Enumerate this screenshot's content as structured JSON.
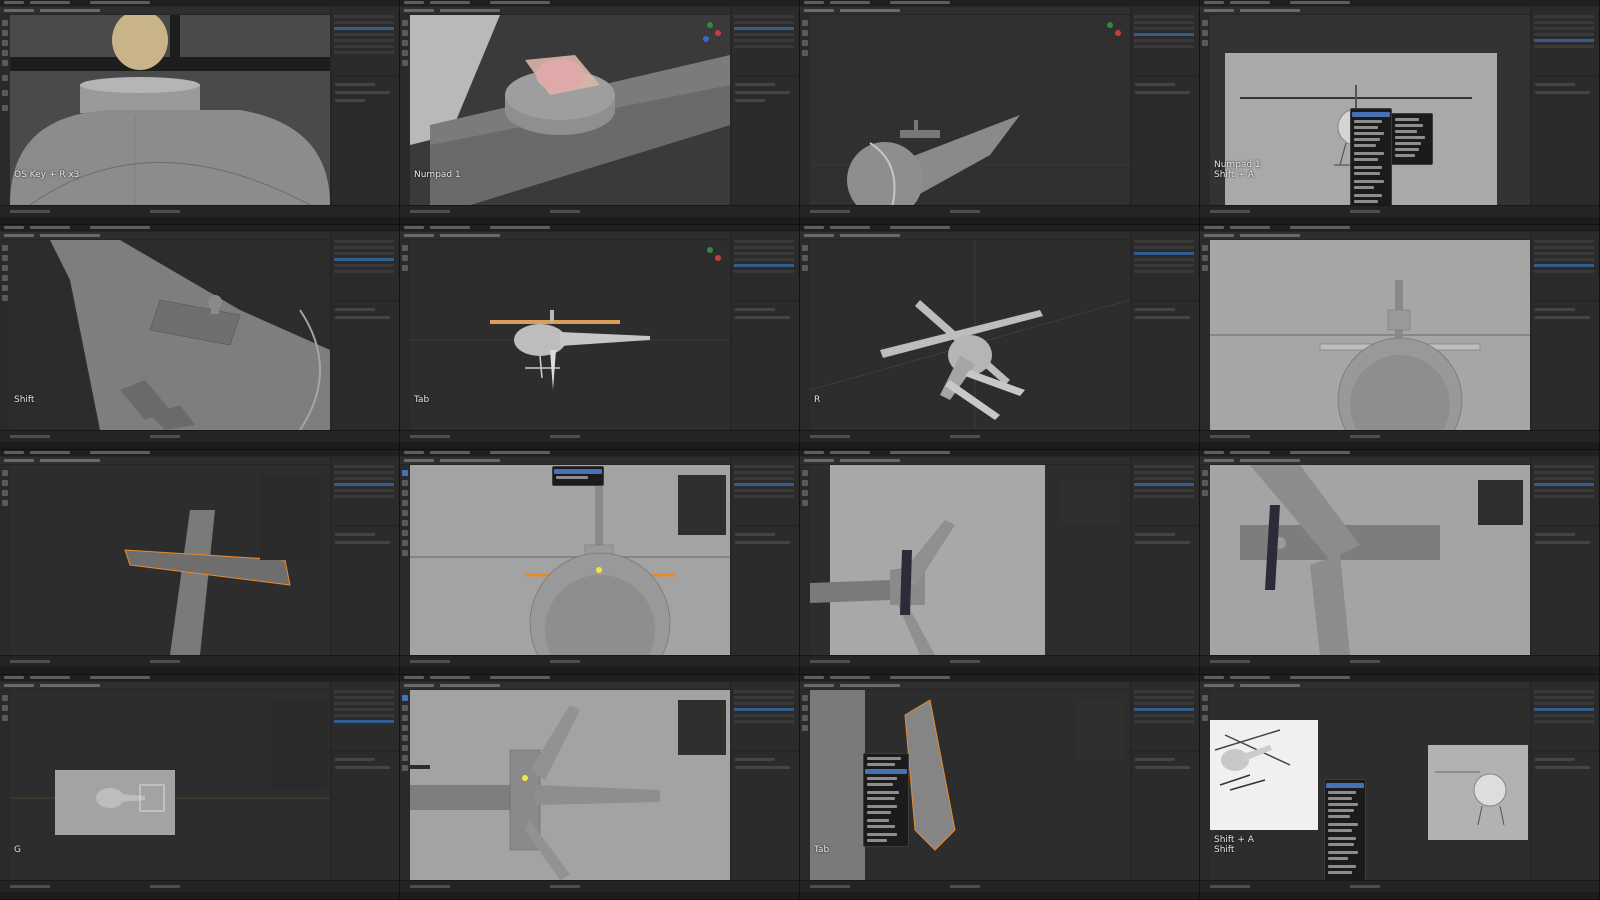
{
  "app": {
    "accent_hex": "#4772b3",
    "selection_hex": "#e88a2c",
    "active_vertex_hex": "#f5e642"
  },
  "tiles": [
    {
      "id": 1,
      "key_overlay": "OS Key + R x3",
      "view": "closeup-cockpit-top"
    },
    {
      "id": 2,
      "key_overlay": "Numpad 1",
      "view": "closeup-boom-disc"
    },
    {
      "id": 3,
      "key_overlay": "",
      "view": "fuselage-side-dark"
    },
    {
      "id": 4,
      "key_overlay": "Numpad 1\nShift + A",
      "view": "front-add-menu"
    },
    {
      "id": 5,
      "key_overlay": "Shift",
      "view": "closeup-rotor-mount"
    },
    {
      "id": 6,
      "key_overlay": "Tab",
      "view": "helicopter-side-small"
    },
    {
      "id": 7,
      "key_overlay": "R",
      "view": "helicopter-perspective-rotors"
    },
    {
      "id": 8,
      "key_overlay": "",
      "view": "front-ortho-rotor"
    },
    {
      "id": 9,
      "key_overlay": "",
      "view": "tail-fin-plane-selected"
    },
    {
      "id": 10,
      "key_overlay": "",
      "view": "front-ortho-edit-vertex"
    },
    {
      "id": 11,
      "key_overlay": "",
      "view": "tail-top-fins"
    },
    {
      "id": 12,
      "key_overlay": "",
      "view": "tail-fin-closeup"
    },
    {
      "id": 13,
      "key_overlay": "G",
      "view": "side-ortho-small-box"
    },
    {
      "id": 14,
      "key_overlay": "",
      "view": "tail-fins-edit-vertex"
    },
    {
      "id": 15,
      "key_overlay": "Tab",
      "view": "fin-context-menu"
    },
    {
      "id": 16,
      "key_overlay": "Shift + A\nShift",
      "view": "render-preview-add-menu"
    }
  ]
}
